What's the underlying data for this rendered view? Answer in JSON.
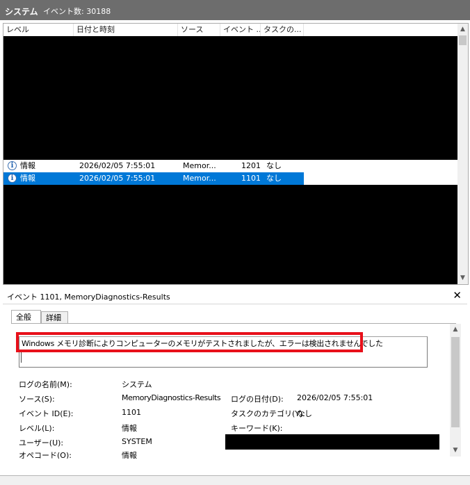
{
  "topbar": {
    "title": "システム",
    "event_count": "イベント数: 30188"
  },
  "list": {
    "columns": [
      "レベル",
      "日付と時刻",
      "ソース",
      "イベント ...",
      "タスクの..."
    ],
    "rows": [
      {
        "level": "情報",
        "datetime": "2026/02/05 7:55:01",
        "source": "Memor...",
        "event_id": "1201",
        "task": "なし",
        "selected": false
      },
      {
        "level": "情報",
        "datetime": "2026/02/05 7:55:01",
        "source": "Memor...",
        "event_id": "1101",
        "task": "なし",
        "selected": true
      }
    ]
  },
  "detail": {
    "title": "イベント 1101, MemoryDiagnostics-Results",
    "close_glyph": "✕",
    "tabs": [
      "全般",
      "詳細"
    ],
    "message": "Windows メモリ診断によりコンピューターのメモリがテストされましたが、エラーは検出されませんでした",
    "props": {
      "log_name_label": "ログの名前(M):",
      "log_name": "システム",
      "source_label": "ソース(S):",
      "source": "MemoryDiagnostics-Results",
      "logged_label": "ログの日付(D):",
      "logged": "2026/02/05 7:55:01",
      "event_id_label": "イベント ID(E):",
      "event_id": "1101",
      "task_label": "タスクのカテゴリ(Y):",
      "task": "なし",
      "level_label": "レベル(L):",
      "level": "情報",
      "keywords_label": "キーワード(K):",
      "user_label": "ユーザー(U):",
      "user": "SYSTEM",
      "opcode_label": "オペコード(O):",
      "opcode": "情報"
    }
  },
  "colors": {
    "selection": "#0078d7",
    "highlight_box": "#e8101a",
    "topbar": "#6d6d6d"
  }
}
